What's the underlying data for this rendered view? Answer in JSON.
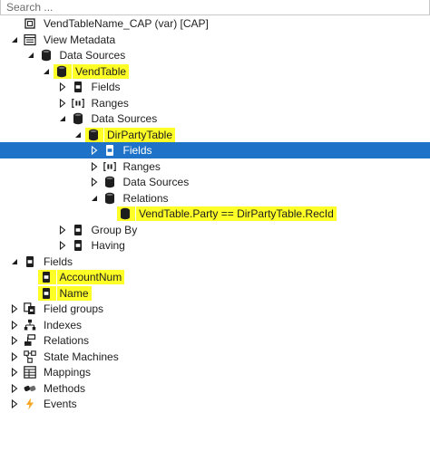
{
  "search": {
    "placeholder": "Search ..."
  },
  "tree": [
    {
      "label": "VendTableName_CAP (var) [CAP]",
      "icon": "view-icon",
      "toggle": "none",
      "level": 0
    },
    {
      "label": "View Metadata",
      "icon": "metadata-icon",
      "toggle": "expanded",
      "level": 0
    },
    {
      "label": "Data Sources",
      "icon": "datasource-icon",
      "toggle": "expanded",
      "level": 1
    },
    {
      "label": "VendTable",
      "icon": "datasource-icon",
      "toggle": "expanded",
      "level": 2,
      "highlight": true
    },
    {
      "label": "Fields",
      "icon": "field-icon",
      "toggle": "collapsed",
      "level": 3
    },
    {
      "label": "Ranges",
      "icon": "range-icon",
      "toggle": "collapsed",
      "level": 3
    },
    {
      "label": "Data Sources",
      "icon": "datasource-icon",
      "toggle": "expanded",
      "level": 3
    },
    {
      "label": "DirPartyTable",
      "icon": "datasource-icon",
      "toggle": "expanded",
      "level": 4,
      "highlight": true
    },
    {
      "label": "Fields",
      "icon": "field-icon",
      "toggle": "collapsed",
      "level": 5,
      "selected": true
    },
    {
      "label": "Ranges",
      "icon": "range-icon",
      "toggle": "collapsed",
      "level": 5
    },
    {
      "label": "Data Sources",
      "icon": "datasource-icon",
      "toggle": "collapsed",
      "level": 5
    },
    {
      "label": "Relations",
      "icon": "datasource-icon",
      "toggle": "expanded",
      "level": 5
    },
    {
      "label": "VendTable.Party == DirPartyTable.RecId",
      "icon": "relation-icon",
      "toggle": "none",
      "level": 6,
      "highlight": true
    },
    {
      "label": "Group By",
      "icon": "field-icon",
      "toggle": "collapsed",
      "level": 3
    },
    {
      "label": "Having",
      "icon": "field-icon",
      "toggle": "collapsed",
      "level": 3
    },
    {
      "label": "Fields",
      "icon": "field-icon",
      "toggle": "expanded",
      "level": 0
    },
    {
      "label": "AccountNum",
      "icon": "field-icon",
      "toggle": "none",
      "level": 1,
      "highlight": true
    },
    {
      "label": "Name",
      "icon": "field-icon",
      "toggle": "none",
      "level": 1,
      "highlight": true
    },
    {
      "label": "Field groups",
      "icon": "fieldgroup-icon",
      "toggle": "collapsed",
      "level": 0
    },
    {
      "label": "Indexes",
      "icon": "index-icon",
      "toggle": "collapsed",
      "level": 0
    },
    {
      "label": "Relations",
      "icon": "relations-icon",
      "toggle": "collapsed",
      "level": 0
    },
    {
      "label": "State Machines",
      "icon": "statemachine-icon",
      "toggle": "collapsed",
      "level": 0
    },
    {
      "label": "Mappings",
      "icon": "mapping-icon",
      "toggle": "collapsed",
      "level": 0
    },
    {
      "label": "Methods",
      "icon": "method-icon",
      "toggle": "collapsed",
      "level": 0
    },
    {
      "label": "Events",
      "icon": "event-icon",
      "toggle": "collapsed",
      "level": 0
    }
  ],
  "colors": {
    "selection": "#1e73c8",
    "highlight": "#ffff28",
    "icon_dark": "#1e1e1e",
    "event_orange": "#f5a623"
  }
}
